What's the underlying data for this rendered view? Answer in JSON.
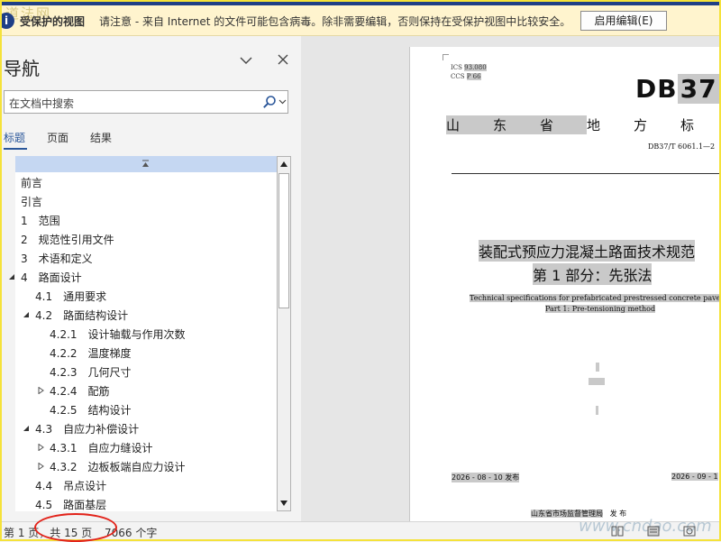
{
  "warning_bar": {
    "watermark": "道法网",
    "title": "受保护的视图",
    "message": "请注意 - 来自 Internet 的文件可能包含病毒。除非需要编辑，否则保持在受保护视图中比较安全。",
    "enable_button": "启用编辑(E)"
  },
  "nav": {
    "title": "导航",
    "search_placeholder": "在文档中搜索",
    "tabs": [
      "标题",
      "页面",
      "结果"
    ],
    "active_tab": 0,
    "items": [
      {
        "num": "",
        "label": "前言",
        "level": 0,
        "toggle": "none"
      },
      {
        "num": "",
        "label": "引言",
        "level": 0,
        "toggle": "none"
      },
      {
        "num": "1",
        "label": "范围",
        "level": 0,
        "toggle": "none"
      },
      {
        "num": "2",
        "label": "规范性引用文件",
        "level": 0,
        "toggle": "none"
      },
      {
        "num": "3",
        "label": "术语和定义",
        "level": 0,
        "toggle": "none"
      },
      {
        "num": "4",
        "label": "路面设计",
        "level": 0,
        "toggle": "expanded"
      },
      {
        "num": "4.1",
        "label": "通用要求",
        "level": 1,
        "toggle": "none"
      },
      {
        "num": "4.2",
        "label": "路面结构设计",
        "level": 1,
        "toggle": "expanded"
      },
      {
        "num": "4.2.1",
        "label": "设计轴载与作用次数",
        "level": 2,
        "toggle": "none"
      },
      {
        "num": "4.2.2",
        "label": "温度梯度",
        "level": 2,
        "toggle": "none"
      },
      {
        "num": "4.2.3",
        "label": "几何尺寸",
        "level": 2,
        "toggle": "none"
      },
      {
        "num": "4.2.4",
        "label": "配筋",
        "level": 2,
        "toggle": "collapsed"
      },
      {
        "num": "4.2.5",
        "label": "结构设计",
        "level": 2,
        "toggle": "none"
      },
      {
        "num": "4.3",
        "label": "自应力补偿设计",
        "level": 1,
        "toggle": "expanded"
      },
      {
        "num": "4.3.1",
        "label": "自应力缝设计",
        "level": 2,
        "toggle": "collapsed"
      },
      {
        "num": "4.3.2",
        "label": "边板板端自应力设计",
        "level": 2,
        "toggle": "collapsed"
      },
      {
        "num": "4.4",
        "label": "吊点设计",
        "level": 1,
        "toggle": "none"
      },
      {
        "num": "4.5",
        "label": "路面基层",
        "level": 1,
        "toggle": "none"
      }
    ]
  },
  "document": {
    "ics_label": "ICS",
    "ics_value": "93.080",
    "ccs_label": "CCS",
    "ccs_value": "P 66",
    "db_prefix": "DB",
    "db_number": "37",
    "province_chars": [
      "山",
      "东",
      "省",
      "地",
      "方",
      "标"
    ],
    "std_code": "DB37/T 6061.1—2",
    "title_line1": "装配式预应力混凝土路面技术规范",
    "title_line2": "第 1 部分：先张法",
    "english_line1": "Technical specifications for prefabricated prestressed concrete pavement—",
    "english_line2": "Part 1: Pre-tensioning method",
    "publish_date": "2026 - 08 - 10 发布",
    "implement_date": "2026 - 09 - 1",
    "issuer": "山东省市场监督管理局",
    "issuer_suffix": "发 布"
  },
  "status": {
    "page_info": "第 1 页，共 15 页",
    "word_count": "7066 个字",
    "watermark": "www.cndao.com"
  },
  "colors": {
    "accent": "#2b579a",
    "warning_bg": "#fff4ce",
    "highlight": "#c9c9c9",
    "annotation": "#e2231a"
  }
}
